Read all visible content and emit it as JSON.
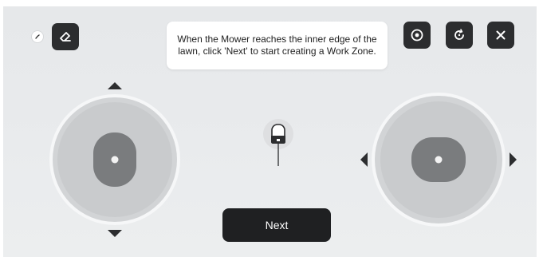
{
  "tooltip": {
    "text": "When the Mower reaches the inner edge of the lawn, click 'Next' to start creating a Work Zone."
  },
  "actions": {
    "next_label": "Next"
  },
  "icons": {
    "small_toggle": "slash-icon",
    "eraser": "eraser-icon",
    "view": "eye-target-icon",
    "refresh": "refresh-icon",
    "close": "close-icon",
    "mower": "mower-icon"
  },
  "colors": {
    "dark_button": "#2c2d2f",
    "joystick_outer": "#d2d4d6",
    "joystick_inner": "#c9cbcd",
    "joystick_knob": "#7a7c7e",
    "background": "#e8eaec"
  }
}
